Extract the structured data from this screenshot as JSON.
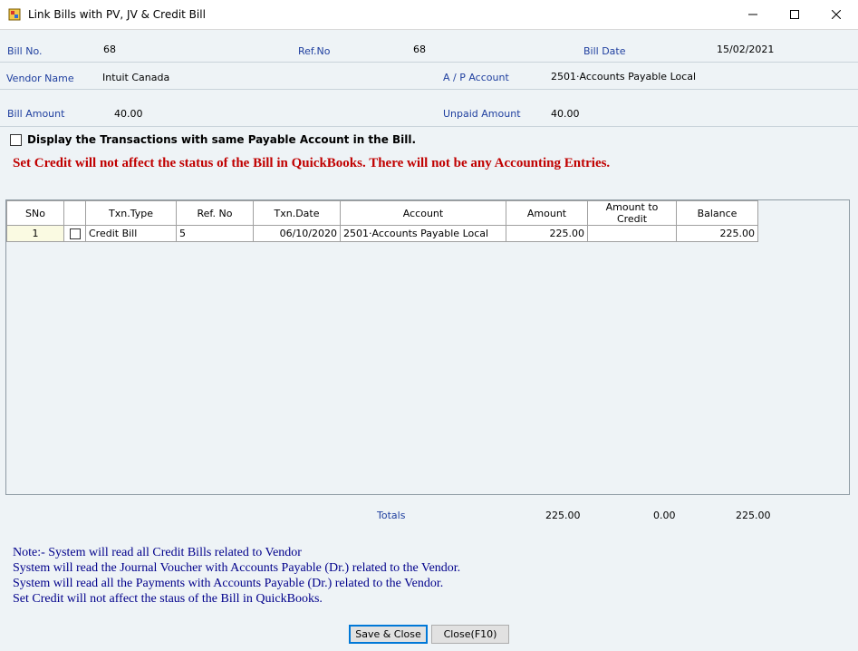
{
  "window": {
    "title": "Link Bills with PV, JV & Credit Bill",
    "minimize_icon": "minimize-icon",
    "maximize_icon": "maximize-icon",
    "close_icon": "close-icon"
  },
  "header": {
    "bill_no_label": "Bill No.",
    "bill_no": "68",
    "ref_no_label": "Ref.No",
    "ref_no": "68",
    "bill_date_label": "Bill Date",
    "bill_date": "15/02/2021",
    "vendor_label": "Vendor Name",
    "vendor": "Intuit Canada",
    "ap_account_label": "A / P Account",
    "ap_account": "2501·Accounts Payable Local",
    "bill_amount_label": "Bill Amount",
    "bill_amount": "40.00",
    "unpaid_label": "Unpaid Amount",
    "unpaid": "40.00"
  },
  "option": {
    "display_same_account_label": "Display the Transactions with same Payable Account in the Bill."
  },
  "warning": "Set Credit will not affect the status of the Bill in QuickBooks. There will not be any Accounting Entries.",
  "grid": {
    "columns": [
      "SNo",
      "",
      "Txn.Type",
      "Ref. No",
      "Txn.Date",
      "Account",
      "Amount",
      "Amount to Credit",
      "Balance"
    ],
    "rows": [
      {
        "sno": "1",
        "txn_type": "Credit Bill",
        "ref_no": "5",
        "txn_date": "06/10/2020",
        "account": "2501·Accounts Payable Local",
        "amount": "225.00",
        "amount_to_credit": "",
        "balance": "225.00"
      }
    ]
  },
  "totals": {
    "label": "Totals",
    "amount": "225.00",
    "amount_to_credit": "0.00",
    "balance": "225.00"
  },
  "notes": [
    "Note:- System will read all Credit Bills related to Vendor",
    "System will read the Journal Voucher with Accounts Payable (Dr.) related to the Vendor.",
    "System will read all the Payments with Accounts Payable (Dr.)  related to the Vendor.",
    "Set Credit will not affect the staus of the Bill in QuickBooks."
  ],
  "buttons": {
    "save_close": "Save & Close",
    "close": "Close(F10)"
  }
}
